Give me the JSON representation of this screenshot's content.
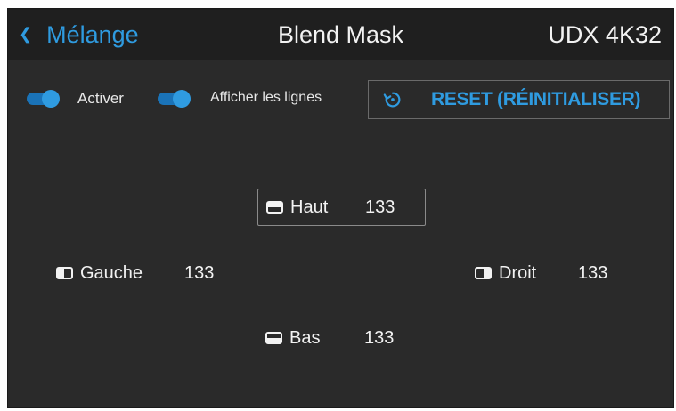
{
  "header": {
    "back_label": "Mélange",
    "title": "Blend Mask",
    "device": "UDX 4K32"
  },
  "toggles": [
    {
      "label": "Activer",
      "on": true
    },
    {
      "label": "Afficher les lignes",
      "on": true
    }
  ],
  "reset_button": {
    "label": "RESET (RÉINITIALISER)",
    "icon": "reset-icon"
  },
  "fields": {
    "top": {
      "label": "Haut",
      "value": "133",
      "icon": "edge-top-icon"
    },
    "left": {
      "label": "Gauche",
      "value": "133",
      "icon": "edge-left-icon"
    },
    "right": {
      "label": "Droit",
      "value": "133",
      "icon": "edge-right-icon"
    },
    "bottom": {
      "label": "Bas",
      "value": "133",
      "icon": "edge-bottom-icon"
    }
  },
  "colors": {
    "accent": "#2f9be0",
    "background": "#2a2a2a",
    "header": "#1f1f1f",
    "text": "#f2f2f2"
  }
}
